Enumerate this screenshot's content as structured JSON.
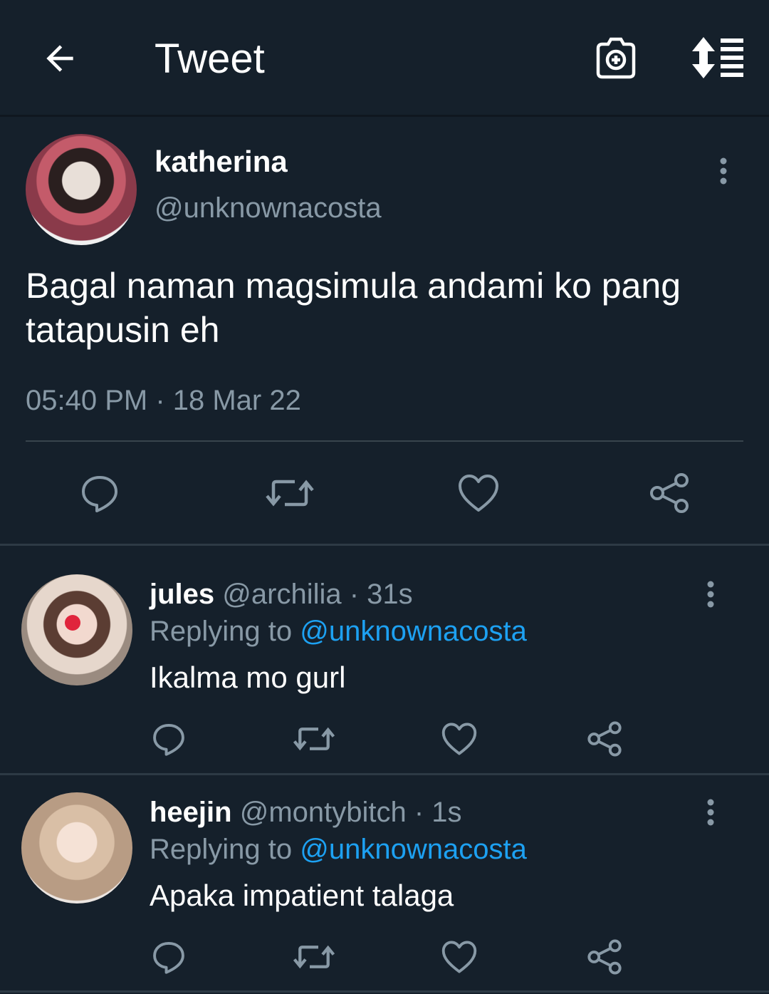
{
  "header": {
    "title": "Tweet",
    "back_icon": "arrow-left-icon",
    "camera_icon": "camera-plus-icon",
    "sort_icon": "sort-list-icon"
  },
  "tweet": {
    "author_name": "katherina",
    "author_handle": "@unknownacosta",
    "text": "Bagal naman magsimula andami ko pang tatapusin eh",
    "timestamp": "05:40 PM · 18 Mar 22",
    "actions": [
      "reply-icon",
      "retweet-icon",
      "like-icon",
      "share-icon"
    ]
  },
  "replies": [
    {
      "name": "jules",
      "handle": "@archilia",
      "time": "· 31s",
      "replying_label": "Replying to",
      "replying_to": "@unknownacosta",
      "text": "Ikalma mo gurl"
    },
    {
      "name": "heejin",
      "handle": "@montybitch",
      "time": "· 1s",
      "replying_label": "Replying to",
      "replying_to": "@unknownacosta",
      "text": "Apaka impatient talaga"
    }
  ],
  "colors": {
    "background": "#15202b",
    "secondary_text": "#8899a6",
    "accent": "#1da1f2",
    "icon": "#8899a6"
  }
}
